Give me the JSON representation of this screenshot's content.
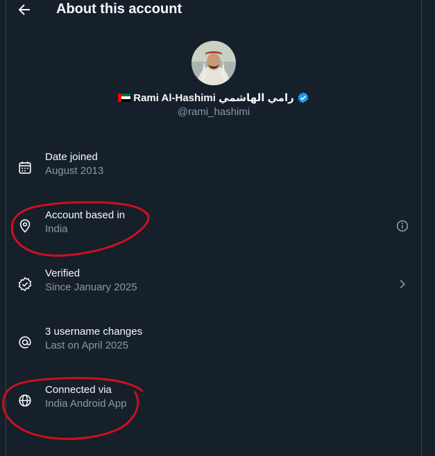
{
  "header": {
    "title": "About this account",
    "back_icon": "arrow-left-icon"
  },
  "profile": {
    "display_name": "Rami Al-Hashimi رامي الهاشمي",
    "handle": "@rami_hashimi",
    "flag": "uae-flag-icon",
    "verified_icon": "verified-badge-icon",
    "verified_color": "#1d9bf0"
  },
  "rows": [
    {
      "label": "Date joined",
      "value": "August 2013",
      "icon": "calendar-icon"
    },
    {
      "label": "Account based in",
      "value": "India",
      "icon": "location-pin-icon",
      "trailing": "info-icon"
    },
    {
      "label": "Verified",
      "value": "Since January 2025",
      "icon": "verified-check-icon",
      "trailing": "chevron-right-icon"
    },
    {
      "label": "3 username changes",
      "value": "Last on April 2025",
      "icon": "at-sign-icon"
    },
    {
      "label": "Connected via",
      "value": "India Android App",
      "icon": "globe-icon"
    }
  ],
  "annotation_color": "#d10f1f",
  "colors": {
    "background": "#15202b",
    "primary_text": "#f7f9f9",
    "secondary_text": "#8b98a5",
    "border": "#38444d"
  }
}
